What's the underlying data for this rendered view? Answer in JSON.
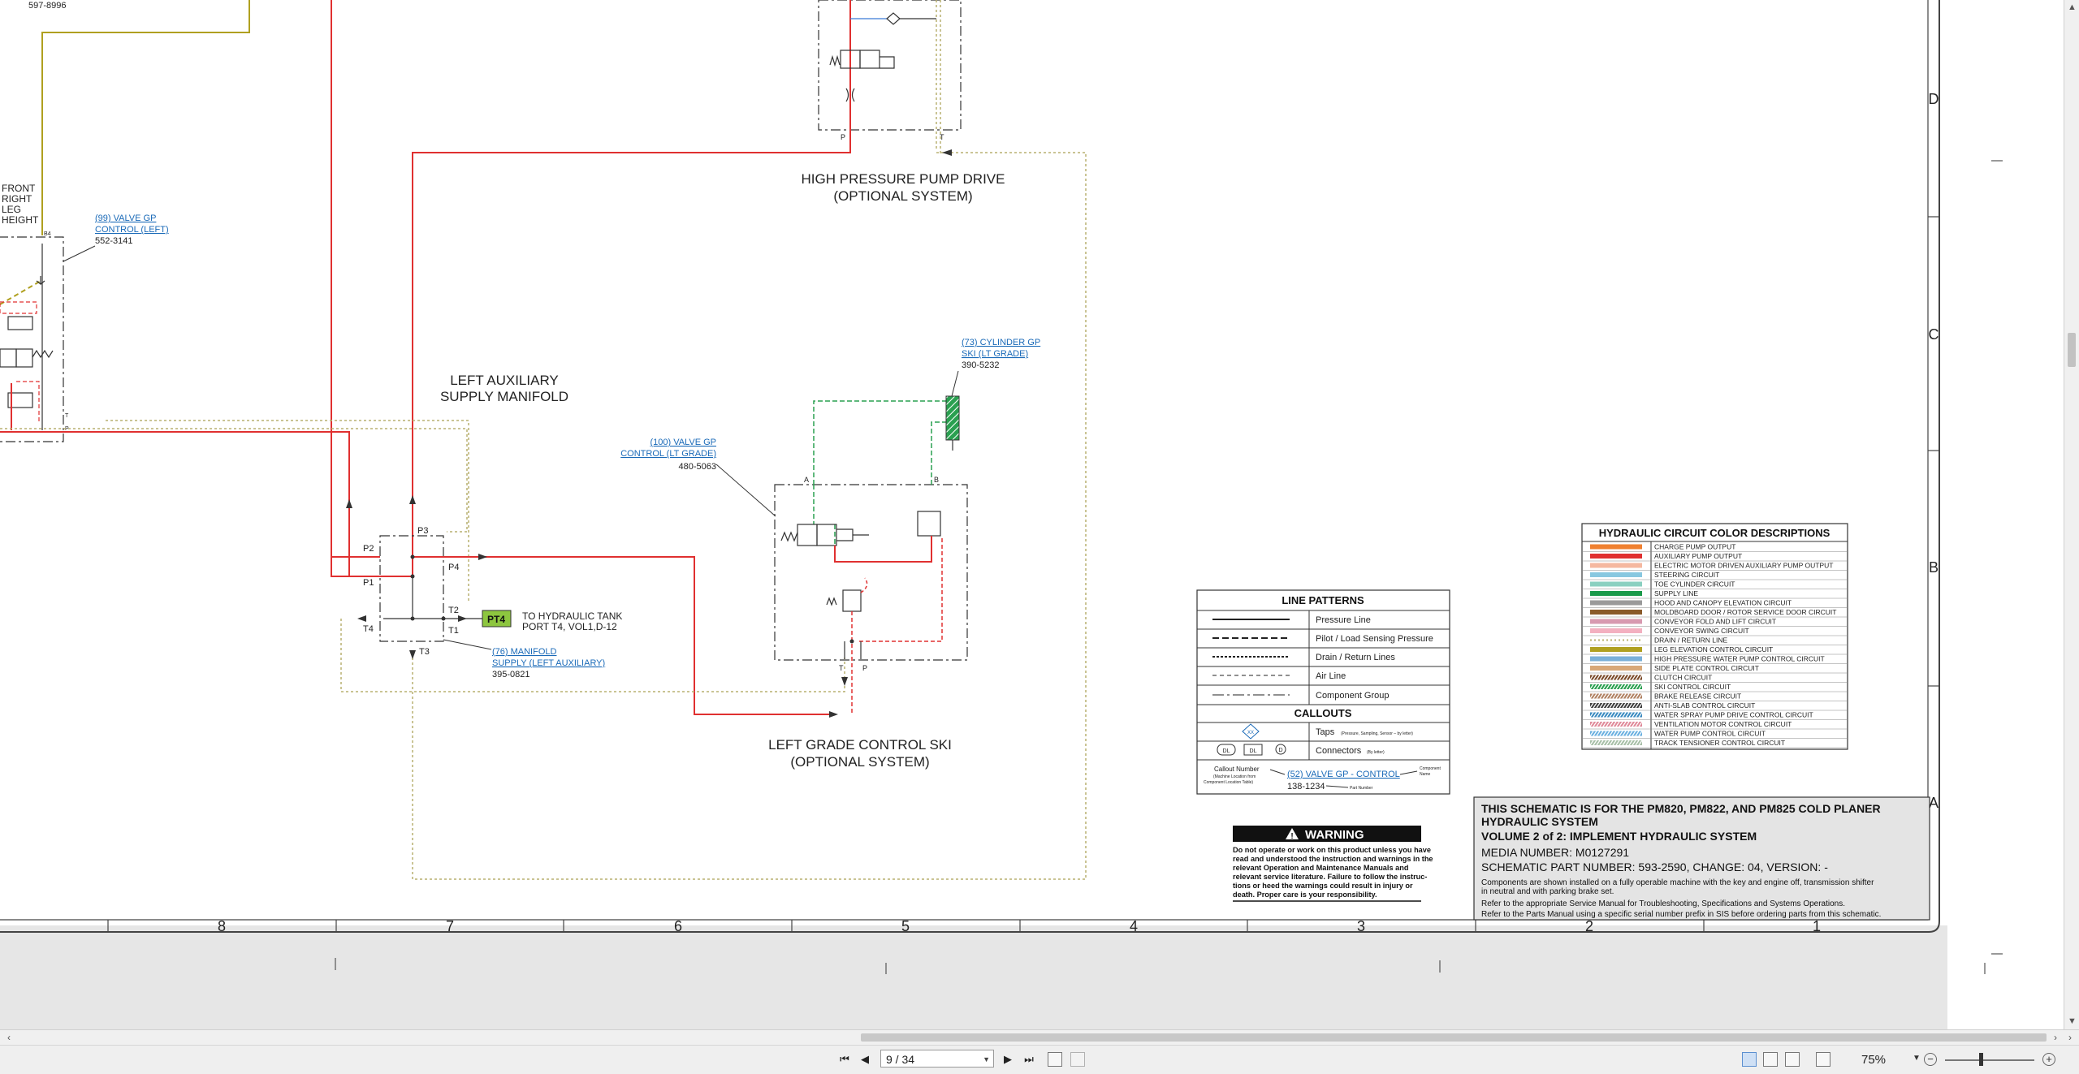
{
  "schematic": {
    "part_ref_top": "597-8996",
    "front_leg_label": [
      "FRONT",
      "RIGHT",
      "LEG",
      "HEIGHT"
    ],
    "valve_99": {
      "link": [
        "(99) VALVE GP",
        "CONTROL (LEFT)"
      ],
      "part": "552-3141",
      "port": "B4"
    },
    "hp_pump_title": [
      "HIGH PRESSURE PUMP DRIVE",
      "(OPTIONAL SYSTEM)"
    ],
    "hp_ports": {
      "p": "P",
      "t": "T"
    },
    "left_aux_title": [
      "LEFT AUXILIARY",
      "SUPPLY MANIFOLD"
    ],
    "manifold_ports": {
      "p1": "P1",
      "p2": "P2",
      "p3": "P3",
      "p4": "P4",
      "t1": "T1",
      "t2": "T2",
      "t3": "T3",
      "t4": "T4"
    },
    "pt4": "PT4",
    "to_tank": [
      "TO HYDRAULIC TANK",
      "PORT T4, VOL1,D-12"
    ],
    "manifold_76": {
      "link": [
        "(76) MANIFOLD",
        "SUPPLY (LEFT AUXILIARY)"
      ],
      "part": "395-0821"
    },
    "valve_100": {
      "link": [
        "(100) VALVE GP",
        "CONTROL (LT GRADE)"
      ],
      "part": "480-5063"
    },
    "cylinder_73": {
      "link": [
        "(73) CYLINDER GP",
        "SKI (LT GRADE)"
      ],
      "part": "390-5232"
    },
    "ski_ports": {
      "a": "A",
      "b": "B",
      "t": "T",
      "p": "P"
    },
    "grade_ski_title": [
      "LEFT GRADE CONTROL SKI",
      "(OPTIONAL SYSTEM)"
    ],
    "line_patterns": {
      "title": "LINE PATTERNS",
      "rows": [
        "Pressure Line",
        "Pilot / Load Sensing Pressure",
        "Drain / Return Lines",
        "Air Line",
        "Component Group"
      ],
      "callouts_title": "CALLOUTS",
      "taps_label": "Taps",
      "taps_note": "(Pressure, Sampling, Sensor – by letter)",
      "taps_symbol": "XX",
      "connectors_label": "Connectors",
      "connectors_note": "(By letter)",
      "connector_symbols": [
        "DL",
        "DL",
        "D"
      ],
      "example_callout_number": "Callout Number",
      "example_callout_sub": [
        "(Machine Location from",
        "Component Location Table)"
      ],
      "example_link": "(52) VALVE GP - CONTROL",
      "example_part": "138-1234",
      "example_component_name": [
        "Component",
        "Name"
      ],
      "example_part_number": "Part Number"
    },
    "warning": {
      "title": "WARNING",
      "text": [
        "Do not operate or work on this product unless you have",
        "read and understood the instruction and warnings in the",
        "relevant Operation and Maintenance Manuals and",
        "relevant service literature. Failure to follow the instruc-",
        "tions or heed the warnings could result in injury or",
        "death. Proper care is your responsibility."
      ]
    },
    "color_desc": {
      "title": "HYDRAULIC CIRCUIT COLOR DESCRIPTIONS",
      "items": [
        {
          "label": "CHARGE PUMP OUTPUT",
          "color": "#f08030",
          "style": "solid"
        },
        {
          "label": "AUXILIARY PUMP OUTPUT",
          "color": "#e03030",
          "style": "solid"
        },
        {
          "label": "ELECTRIC MOTOR DRIVEN AUXILIARY PUMP OUTPUT",
          "color": "#f5b8a0",
          "style": "solid"
        },
        {
          "label": "STEERING CIRCUIT",
          "color": "#88c8e0",
          "style": "solid"
        },
        {
          "label": "TOE CYLINDER CIRCUIT",
          "color": "#8ad0c0",
          "style": "solid"
        },
        {
          "label": "SUPPLY LINE",
          "color": "#1a9a4a",
          "style": "solid"
        },
        {
          "label": "HOOD AND CANOPY ELEVATION CIRCUIT",
          "color": "#9a9a9a",
          "style": "solid"
        },
        {
          "label": "MOLDBOARD DOOR / ROTOR SERVICE DOOR CIRCUIT",
          "color": "#8a5a2a",
          "style": "solid"
        },
        {
          "label": "CONVEYOR FOLD AND LIFT CIRCUIT",
          "color": "#d89ab0",
          "style": "solid"
        },
        {
          "label": "CONVEYOR SWING CIRCUIT",
          "color": "#f3b0c0",
          "style": "solid"
        },
        {
          "label": "DRAIN / RETURN LINE",
          "color": "#b8b070",
          "style": "dotted"
        },
        {
          "label": "LEG ELEVATION CONTROL CIRCUIT",
          "color": "#b0a020",
          "style": "solid"
        },
        {
          "label": "HIGH PRESSURE WATER PUMP CONTROL CIRCUIT",
          "color": "#7ab0d8",
          "style": "solid"
        },
        {
          "label": "SIDE PLATE CONTROL CIRCUIT",
          "color": "#d8a878",
          "style": "solid"
        },
        {
          "label": "CLUTCH CIRCUIT",
          "color": "#7a4a2a",
          "style": "hatch"
        },
        {
          "label": "SKI CONTROL CIRCUIT",
          "color": "#2aa050",
          "style": "hatch"
        },
        {
          "label": "BRAKE RELEASE CIRCUIT",
          "color": "#b08060",
          "style": "hatch"
        },
        {
          "label": "ANTI-SLAB CONTROL CIRCUIT",
          "color": "#404040",
          "style": "hatch"
        },
        {
          "label": "WATER SPRAY PUMP DRIVE CONTROL CIRCUIT",
          "color": "#3a8ac0",
          "style": "hatch"
        },
        {
          "label": "VENTILATION MOTOR CONTROL CIRCUIT",
          "color": "#e08a9a",
          "style": "hatch"
        },
        {
          "label": "WATER PUMP CONTROL CIRCUIT",
          "color": "#6ab0e0",
          "style": "hatch"
        },
        {
          "label": "TRACK TENSIONER CONTROL CIRCUIT",
          "color": "#a8c0a8",
          "style": "hatch"
        }
      ]
    },
    "title_block": {
      "line1": "THIS SCHEMATIC IS FOR THE PM820, PM822, AND PM825 COLD PLANER",
      "line2": "HYDRAULIC SYSTEM",
      "line3": "VOLUME 2 of 2: IMPLEMENT HYDRAULIC SYSTEM",
      "media": "MEDIA NUMBER: M0127291",
      "part": "SCHEMATIC PART NUMBER: 593-2590, CHANGE: 04, VERSION: -",
      "note1": "Components are shown installed on a fully operable machine with the key and engine off, transmission shifter",
      "note2": "in neutral and with parking brake set.",
      "note3": "Refer to the appropriate Service Manual for Troubleshooting, Specifications and Systems Operations.",
      "note4": "Refer to the Parts Manual using a specific serial number prefix in SIS before ordering parts from this schematic."
    },
    "grid_cols": [
      "8",
      "7",
      "6",
      "5",
      "4",
      "3",
      "2",
      "1"
    ],
    "grid_rows": [
      "D",
      "C",
      "B",
      "A"
    ]
  },
  "viewer": {
    "page_value": "9 / 34",
    "zoom": "75%",
    "nav": {
      "first": "⏮",
      "prev": "◀",
      "next": "▶",
      "last": "⏭"
    }
  }
}
